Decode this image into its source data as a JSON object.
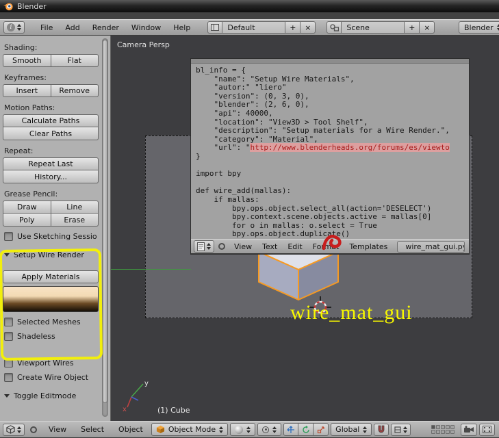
{
  "colors": {
    "selection_orange": "#f79a22",
    "annotation_yellow": "#f2ef0c",
    "url_text_red": "#a81d1d",
    "url_highlight_pink": "#dd9f9f",
    "swatch_top": "#f8e3c5",
    "swatch_bottom": "#140e06"
  },
  "icons": {
    "info": "i",
    "add": "+",
    "close": "×"
  },
  "titlebar": {
    "app_name": "Blender"
  },
  "menubar": {
    "menus": {
      "file": "File",
      "add": "Add",
      "render": "Render",
      "window": "Window",
      "help": "Help"
    },
    "layout_selector": {
      "value": "Default"
    },
    "scene_selector": {
      "value": "Scene"
    },
    "engine_selector": {
      "value": "Blender"
    }
  },
  "tool_shelf": {
    "shading": {
      "label": "Shading:",
      "smooth": "Smooth",
      "flat": "Flat"
    },
    "keyframes": {
      "label": "Keyframes:",
      "insert": "Insert",
      "remove": "Remove"
    },
    "motion_paths": {
      "label": "Motion Paths:",
      "calculate": "Calculate Paths",
      "clear": "Clear Paths"
    },
    "repeat": {
      "label": "Repeat:",
      "repeat_last": "Repeat Last",
      "history": "History..."
    },
    "grease_pencil": {
      "label": "Grease Pencil:",
      "draw": "Draw",
      "line": "Line",
      "poly": "Poly",
      "erase": "Erase",
      "use_sketching": "Use Sketching Sessio"
    },
    "wire_panel": {
      "title": "Setup Wire Render",
      "apply_materials": "Apply Materials",
      "selected_meshes": "Selected Meshes",
      "shadeless": "Shadeless",
      "viewport_wires": "Viewport Wires",
      "create_wire_object": "Create Wire Object"
    },
    "editmode_panel": {
      "title": "Toggle Editmode"
    }
  },
  "viewport": {
    "view_label": "Camera Persp",
    "object_info": "(1) Cube",
    "annotation_text": "wire_mat_gui",
    "axis_labels": {
      "x": "x",
      "y": "y"
    }
  },
  "text_editor": {
    "code_before_url": [
      "bl_info = {",
      "    \"name\": \"Setup Wire Materials\",",
      "    \"autor:\" \"liero\"",
      "    \"version\": (0, 3, 0),",
      "    \"blender\": (2, 6, 0),",
      "    \"api\": 40000,",
      "    \"location\": \"View3D > Tool Shelf\",",
      "    \"description\": \"Setup materials for a Wire Render.\",",
      "    \"category\": \"Material\",",
      "    \"url\": \""
    ],
    "url_text": "http://www.blenderheads.org/forums/es/viewto",
    "code_after_url": [
      "",
      "}",
      "",
      "import bpy",
      "",
      "def wire_add(mallas):",
      "    if mallas:",
      "        bpy.ops.object.select_all(action='DESELECT')",
      "        bpy.context.scene.objects.active = mallas[0]",
      "        for o in mallas: o.select = True",
      "        bpy.ops.object.duplicate()"
    ],
    "menus": {
      "view": "View",
      "text": "Text",
      "edit": "Edit",
      "format": "Format",
      "templates": "Templates"
    },
    "filename": "wire_mat_gui.py"
  },
  "bottom_bar": {
    "menus": {
      "view": "View",
      "select": "Select",
      "object": "Object"
    },
    "mode_selector": "Object Mode",
    "orientation_selector": "Global"
  }
}
